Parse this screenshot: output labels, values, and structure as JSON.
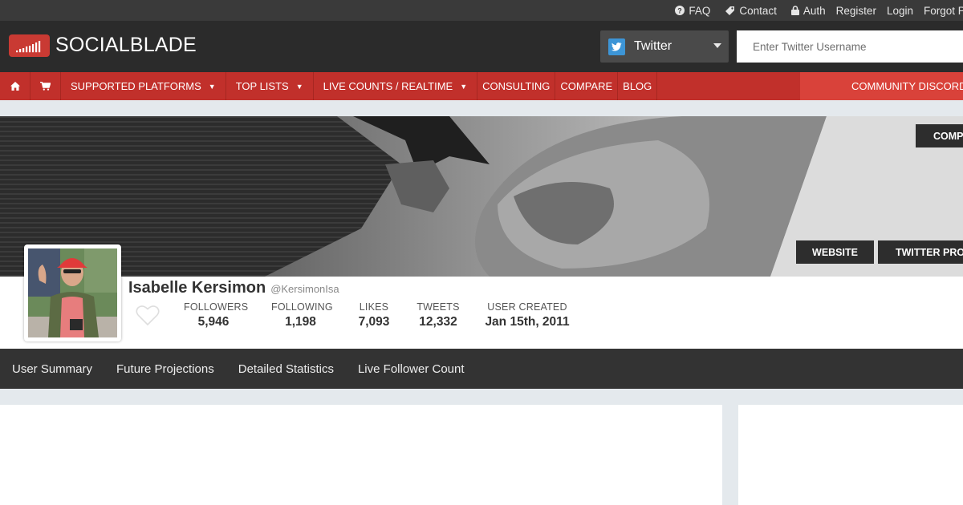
{
  "topbar": {
    "links": [
      {
        "label": "FAQ",
        "icon": "question-circle-icon"
      },
      {
        "label": "Contact",
        "icon": "tag-icon"
      },
      {
        "label": "Auth",
        "icon": "lock-icon"
      },
      {
        "label": "Register"
      },
      {
        "label": "Login"
      },
      {
        "label": "Forgot Pa"
      }
    ]
  },
  "header": {
    "logo_text": "SOCIALBLADE",
    "platform": {
      "selected": "Twitter",
      "icon": "twitter-bird-icon"
    },
    "search": {
      "placeholder": "Enter Twitter Username"
    }
  },
  "nav": {
    "icons": [
      "home-icon",
      "shopping-cart-icon"
    ],
    "items": [
      {
        "label": "SUPPORTED PLATFORMS",
        "dropdown": "▼"
      },
      {
        "label": "TOP LISTS",
        "dropdown": "▼"
      },
      {
        "label": "LIVE COUNTS / REALTIME",
        "dropdown": "▼"
      },
      {
        "label": "CONSULTING"
      },
      {
        "label": "COMPARE"
      },
      {
        "label": "BLOG"
      }
    ],
    "discord_label": "COMMUNITY DISCORD"
  },
  "banner": {
    "buttons": {
      "compare": "COMPA",
      "website": "WEBSITE",
      "profile": "TWITTER PROF"
    }
  },
  "profile": {
    "name": "Isabelle Kersimon",
    "handle": "@KersimonIsa",
    "stats": [
      {
        "label": "FOLLOWERS",
        "value": "5,946"
      },
      {
        "label": "FOLLOWING",
        "value": "1,198"
      },
      {
        "label": "LIKES",
        "value": "7,093"
      },
      {
        "label": "TWEETS",
        "value": "12,332"
      },
      {
        "label": "USER CREATED",
        "value": "Jan 15th, 2011"
      }
    ]
  },
  "tabs": [
    {
      "label": "User Summary"
    },
    {
      "label": "Future Projections"
    },
    {
      "label": "Detailed Statistics"
    },
    {
      "label": "Live Follower Count"
    }
  ],
  "colors": {
    "brand_red": "#c1302b",
    "discord_red": "#d9423a",
    "dark_header": "#2b2b2b",
    "tab_bar": "#333333",
    "twitter_blue": "#3d95d6"
  }
}
